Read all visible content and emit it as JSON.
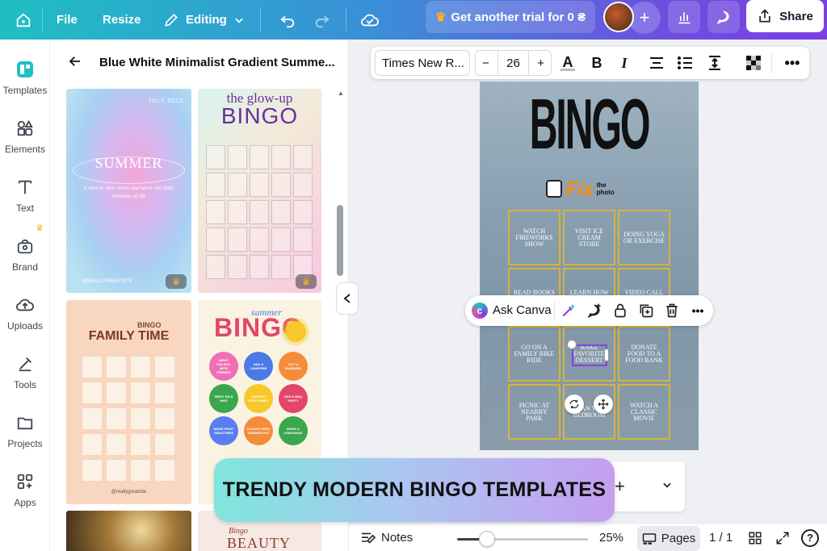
{
  "topbar": {
    "file": "File",
    "resize": "Resize",
    "editing": "Editing",
    "trial": "Get another trial for 0 ₴",
    "share": "Share"
  },
  "rail": [
    {
      "label": "Templates",
      "icon": "templates-icon"
    },
    {
      "label": "Elements",
      "icon": "elements-icon"
    },
    {
      "label": "Text",
      "icon": "text-icon"
    },
    {
      "label": "Brand",
      "icon": "brand-icon"
    },
    {
      "label": "Uploads",
      "icon": "uploads-icon"
    },
    {
      "label": "Tools",
      "icon": "tools-icon"
    },
    {
      "label": "Projects",
      "icon": "projects-icon"
    },
    {
      "label": "Apps",
      "icon": "apps-icon"
    }
  ],
  "panel": {
    "title": "Blue White Minimalist Gradient Summe...",
    "thumb1": {
      "title": "SUMMER",
      "date": "JULY 2023",
      "tagline": "a time to slow down and savor the little moments of life",
      "handle": "@REALLYGREATSITE"
    },
    "thumb2": {
      "line1": "the glow-up",
      "line2": "BINGO"
    },
    "thumb3": {
      "line1": "BINGO",
      "line2": "FAMILY TIME",
      "handle": "@reallygreatsite"
    },
    "thumb4": {
      "line1": "summer",
      "line2": "BINGO",
      "circles": [
        "WENT HOLIDAY WITH FRIENDS",
        "HAD A CAMPFIRE",
        "GOT A SUNBURN",
        "WENT ON A HIKE",
        "SURFING WITH FAMILY",
        "HAD A BBQ PARTY",
        "MADE FRUIT SMOOTHIES",
        "BOUGHT NEW SUMMER HAT",
        "MADE A LEMONADE"
      ]
    },
    "thumb6": {
      "line1": "Bingo",
      "line2": "BEAUTY"
    }
  },
  "format_bar": {
    "font": "Times New R...",
    "size": "26"
  },
  "design": {
    "title": "BINGO",
    "logo_word": "Fix",
    "logo_small": "the photo",
    "cells": [
      "WATCH FIREWORKS SHOW",
      "VISIT ICE CREAM STORE",
      "DOING YOGA OR EXERCISE",
      "READ BOOKS AT",
      "LEARN HOW TO PLAY",
      "VIDEO CALL WITH",
      "GO ON A FAMILY BIKE RIDE",
      "BAKE FAVORITE DESSERT",
      "DONATE FOOD TO A FOOD BANK",
      "PICNIC AT NEARBY PARK",
      "CLEAN YOUR BEDROOM",
      "WATCH A CLASSIC MOVIE"
    ]
  },
  "ask_bar": {
    "label": "Ask Canva"
  },
  "banner": {
    "text": "TRENDY MODERN BINGO TEMPLATES"
  },
  "bottom": {
    "notes": "Notes",
    "zoom": "25%",
    "zoom_value": 0.25,
    "pages": "Pages",
    "page_count": "1 / 1"
  },
  "colors": {
    "accent": "#7b3fe4",
    "teal": "#1fbfc3",
    "cell_border": "#d9b23a",
    "fix_orange": "#f28c1e"
  }
}
